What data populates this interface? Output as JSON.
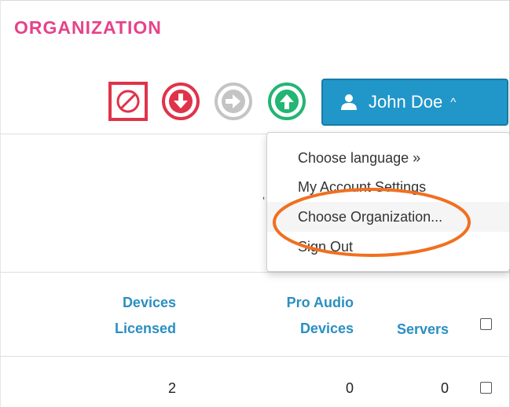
{
  "header": {
    "title": "ORGANIZATION"
  },
  "toolbar": {
    "icons": [
      "block-icon",
      "download-arrow-icon",
      "forward-arrow-icon",
      "upload-arrow-icon"
    ]
  },
  "user_menu": {
    "name": "John Doe",
    "caret": "^",
    "items": [
      {
        "label": "Choose language  »"
      },
      {
        "label": "My Account Settings"
      },
      {
        "label": "Choose Organization..."
      },
      {
        "label": "Sign Out"
      }
    ],
    "highlighted_item": "Choose Organization..."
  },
  "table": {
    "columns": {
      "devices_licensed": {
        "line1": "Devices",
        "line2": "Licensed"
      },
      "pro_audio_devices": {
        "line1": "Pro Audio",
        "line2": "Devices"
      },
      "servers": "Servers"
    },
    "rows": [
      {
        "devices_licensed": "2",
        "pro_audio_devices": "0",
        "servers": "0"
      }
    ]
  },
  "colors": {
    "brand": "#e6428a",
    "accent": "#2196c9",
    "header_text": "#2a8fc2",
    "annotation": "#f07020",
    "block_red": "#e0334a",
    "gray": "#c4c4c4",
    "green": "#22b573"
  }
}
